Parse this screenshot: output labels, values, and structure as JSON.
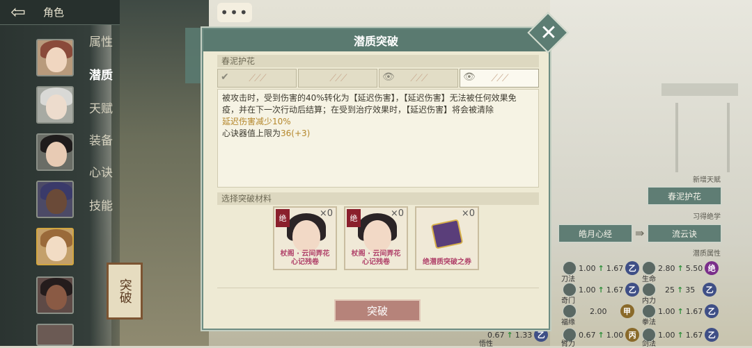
{
  "topbar": {
    "back_icon": "back-arrow-icon",
    "title": "角色"
  },
  "sidebar": {
    "menu": [
      {
        "label": "属性",
        "active": false
      },
      {
        "label": "潜质",
        "active": true
      },
      {
        "label": "天赋",
        "active": false
      },
      {
        "label": "装备",
        "active": false
      },
      {
        "label": "心诀",
        "active": false
      },
      {
        "label": "技能",
        "active": false
      }
    ],
    "breakthrough_label": "突破"
  },
  "chat": {
    "label": "•••"
  },
  "modal": {
    "title": "潜质突破",
    "close_icon": "close-icon",
    "potential_name": "春泥护花",
    "rank_tabs": [
      {
        "mark": "✔",
        "state": "unlocked"
      },
      {
        "mark": "",
        "state": "normal"
      },
      {
        "mark": "👁",
        "state": "preview"
      },
      {
        "mark": "👁",
        "state": "preview-active"
      }
    ],
    "description": {
      "line1": "被攻击时，受到伤害的40%转化为【延迟伤害】，【延迟伤害】无法被任何效果免",
      "line2": "疫，并在下一次行动后结算；在受到治疗效果时，【延迟伤害】将会被清除",
      "line3": "延迟伤害减少10%",
      "line4_prefix": "心诀器值上限为",
      "line4_value": "36(+3)"
    },
    "materials_header": "选择突破材料",
    "materials": [
      {
        "tag": "绝",
        "count": "×0",
        "caption": "杖阁 · 云间弄花\n心记残卷"
      },
      {
        "tag": "绝",
        "count": "×0",
        "caption": "杖阁 · 云间弄花\n心记残卷"
      },
      {
        "tag": "",
        "count": "×0",
        "caption": "绝潜质突破之券"
      }
    ],
    "confirm_label": "突破"
  },
  "right_panel": {
    "new_talent_label": "新增天赋",
    "new_talent_value": "春泥护花",
    "learned_label": "习得绝学",
    "learned_from": "皓月心经",
    "learned_to": "流云诀",
    "potential_attr_label": "潜质属性",
    "stats": [
      {
        "name": "刀法",
        "from": "1.00",
        "to": "1.67",
        "badge": "乙"
      },
      {
        "name": "生命",
        "from": "2.80",
        "to": "5.50",
        "badge": "绝"
      },
      {
        "name": "奇门",
        "from": "1.00",
        "to": "1.67",
        "badge": "乙"
      },
      {
        "name": "内力",
        "from": "25",
        "to": "35",
        "badge": "乙"
      },
      {
        "name": "福缘",
        "from": "",
        "to": "2.00",
        "badge": "甲"
      },
      {
        "name": "拳法",
        "from": "1.00",
        "to": "1.67",
        "badge": "乙"
      },
      {
        "name": "悟性",
        "from": "0.67",
        "to": "1.33",
        "badge": "乙"
      },
      {
        "name": "臂力",
        "from": "0.67",
        "to": "1.00",
        "badge": "丙"
      },
      {
        "name": "剑法",
        "from": "1.00",
        "to": "1.67",
        "badge": "乙"
      }
    ]
  }
}
